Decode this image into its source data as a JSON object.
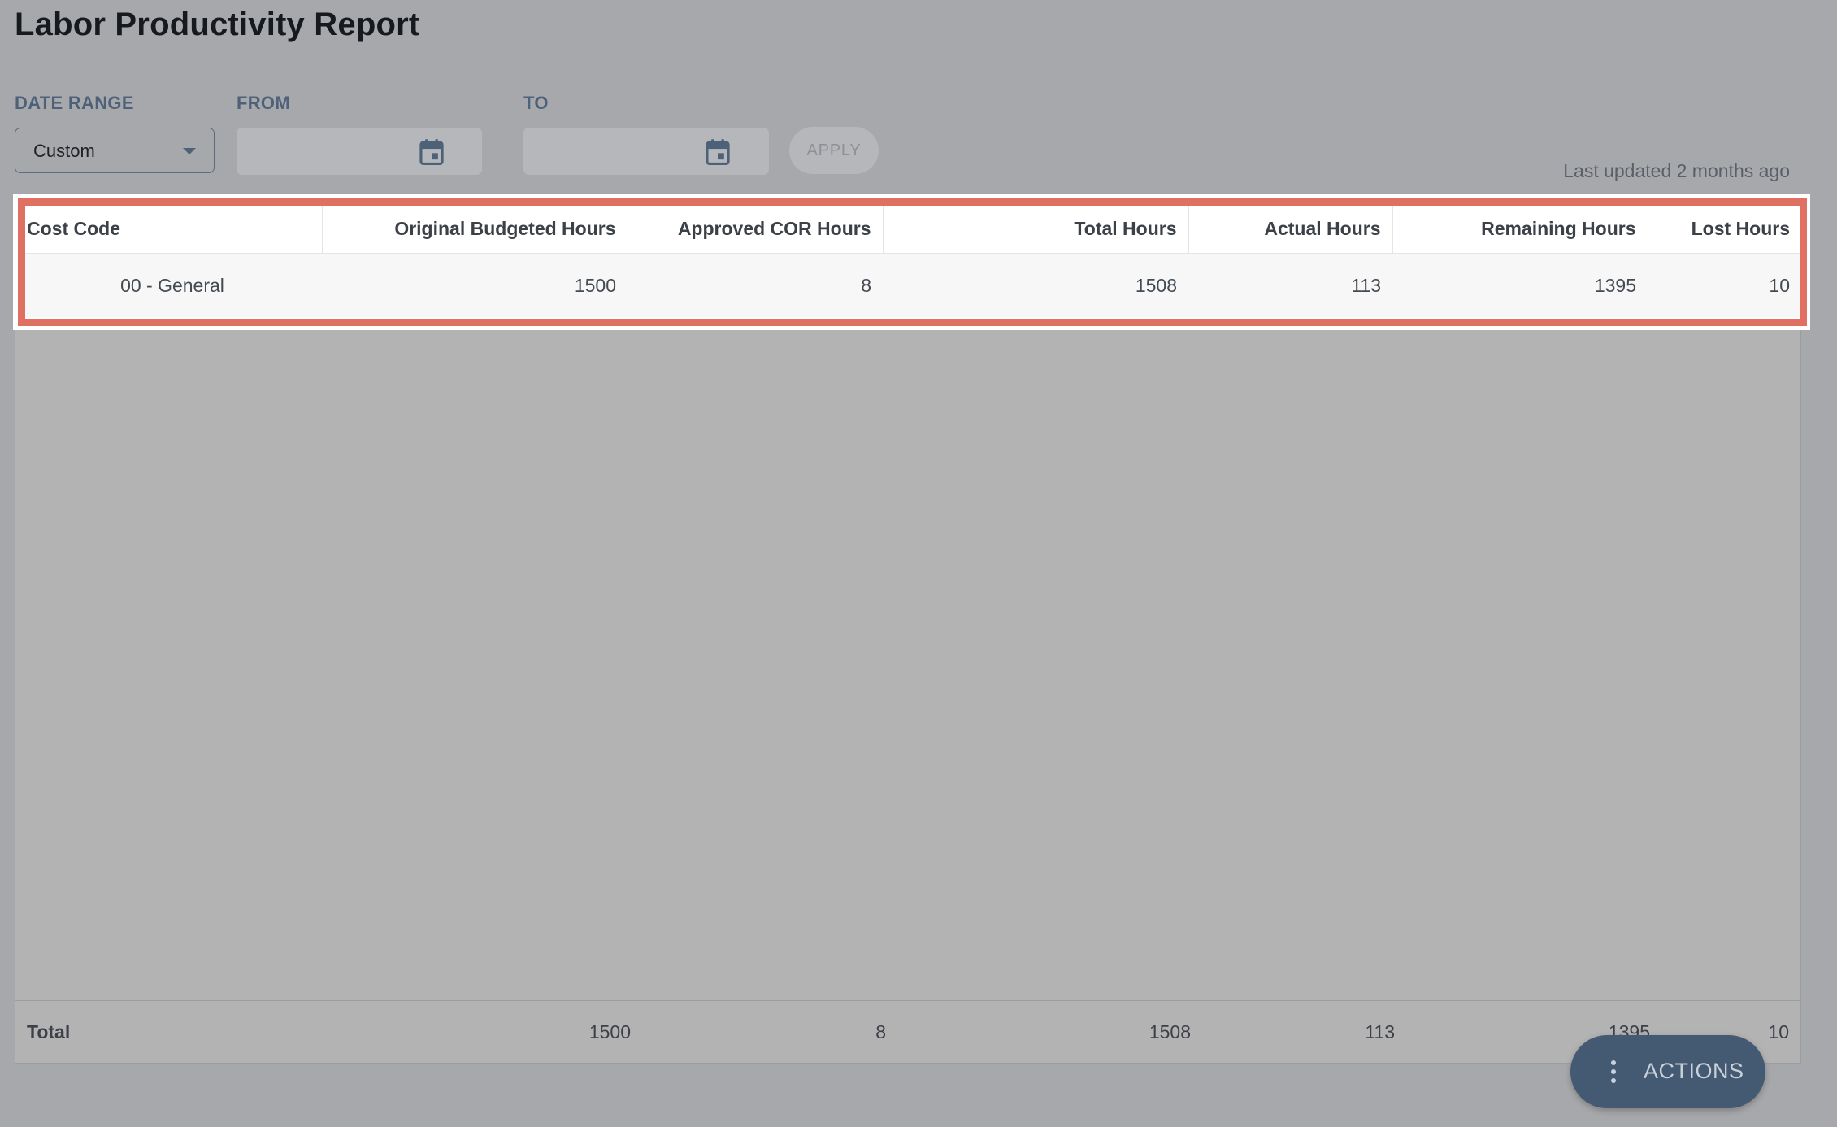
{
  "page": {
    "title": "Labor Productivity Report",
    "last_updated": "Last updated 2 months ago"
  },
  "filters": {
    "date_range_label": "DATE RANGE",
    "date_range_value": "Custom",
    "from_label": "FROM",
    "from_value": "",
    "to_label": "TO",
    "to_value": "",
    "apply_label": "APPLY"
  },
  "table": {
    "columns": [
      "Cost Code",
      "Original Budgeted Hours",
      "Approved COR Hours",
      "Total Hours",
      "Actual Hours",
      "Remaining Hours",
      "Lost Hours"
    ],
    "rows": [
      [
        "00 - General",
        "1500",
        "8",
        "1508",
        "113",
        "1395",
        "10"
      ]
    ],
    "totals": [
      "Total",
      "1500",
      "8",
      "1508",
      "113",
      "1395",
      "10"
    ]
  },
  "actions": {
    "label": "ACTIONS"
  },
  "icons": {
    "date_range_dropdown": "chevron-down-icon",
    "from_picker": "calendar-icon",
    "to_picker": "calendar-icon",
    "actions_menu": "more-vertical-icon"
  },
  "colors": {
    "highlight": "#df7062",
    "accent": "#445972",
    "label": "#4d6178"
  }
}
